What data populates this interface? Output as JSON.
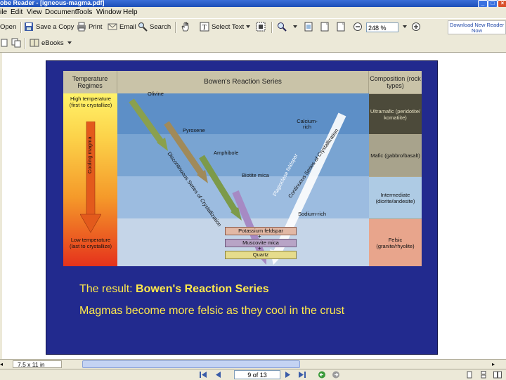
{
  "window": {
    "title": "obe Reader - [igneous-magma.pdf]"
  },
  "menu": [
    "ile",
    "Edit",
    "View",
    "Document",
    "Tools",
    "Window",
    "Help"
  ],
  "toolbar": {
    "open": "Open",
    "save_copy": "Save a Copy",
    "print": "Print",
    "email": "Email",
    "search": "Search",
    "select_text": "Select Text",
    "zoom_value": "248 %",
    "download": "Download New Reader Now",
    "ebooks": "eBooks"
  },
  "slide": {
    "figure": {
      "headers": {
        "left": "Temperature Regimes",
        "center": "Bowen's Reaction Series",
        "right": "Composition (rock types)"
      },
      "high_temp": "High temperature (first to crystallize)",
      "low_temp": "Low temperature (last to crystallize)",
      "cooling": "Cooling magma",
      "minerals": {
        "olivine": "Olivine",
        "pyroxene": "Pyroxene",
        "amphibole": "Amphibole",
        "biotite": "Biotite mica",
        "calcium": "Calcium-rich",
        "sodium": "Sodium-rich",
        "k_feldspar": "Potassium feldspar",
        "muscovite": "Muscovite mica",
        "quartz": "Quartz"
      },
      "discontinuous": "Discontinuous Series of Crystallization",
      "plagioclase": "Plagioclase feldspar",
      "continuous": "Continuous Series of Crystallization",
      "compositions": [
        "Ultramafic (peridotite/ komatiite)",
        "Mafic (gabbro/basalt)",
        "Intermediate (diorite/andesite)",
        "Felsic (granite/rhyolite)"
      ]
    },
    "result_prefix": "The result: ",
    "result_bold": "Bowen's Reaction Series",
    "magma_line": "Magmas become more felsic as they cool in the crust"
  },
  "status": {
    "page_size": "7.5 x 11 in",
    "page_indicator": "9 of 13"
  },
  "colors": {
    "slide_bg": "#222a8e",
    "slide_text": "#ffe94a",
    "chrome": "#ece9d8"
  }
}
